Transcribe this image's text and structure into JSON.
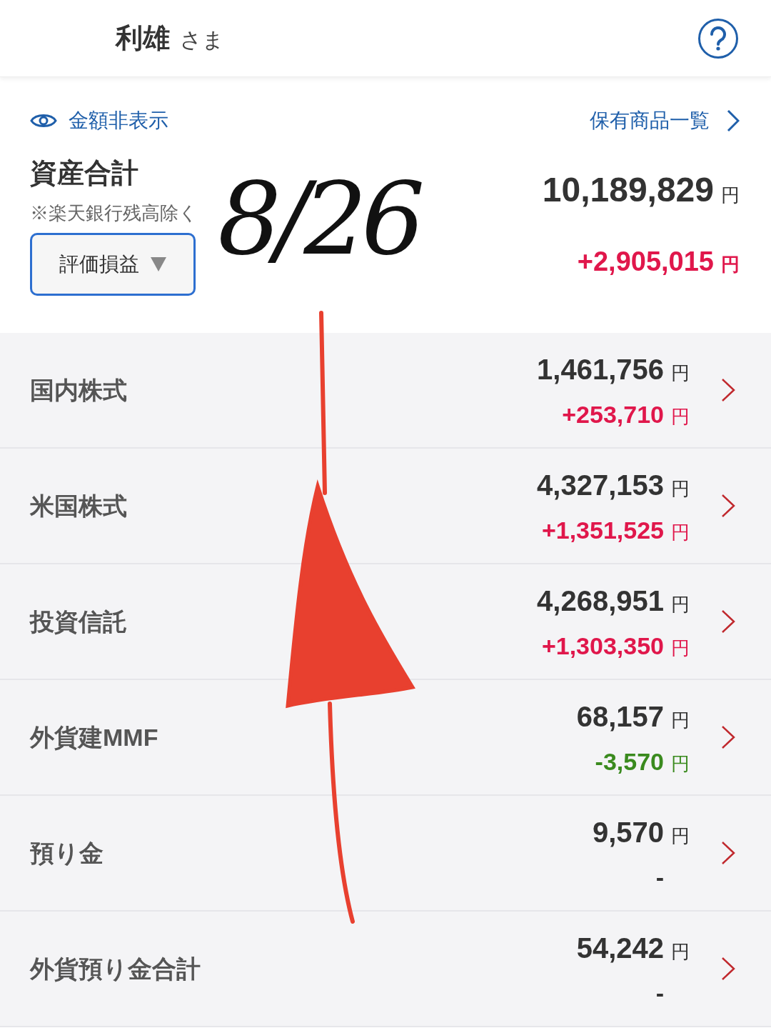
{
  "header": {
    "name": "利雄",
    "honorific": "さま"
  },
  "summary": {
    "hide_amounts": "金額非表示",
    "holdings_link": "保有商品一覧",
    "title": "資産合計",
    "note": "※楽天銀行残高除く",
    "selector": "評価損益",
    "total": {
      "amount": "10,189,829",
      "unit": "円"
    },
    "change": {
      "amount": "+2,905,015",
      "unit": "円",
      "color": "#e0174b"
    }
  },
  "rows": [
    {
      "label": "国内株式",
      "value": {
        "amount": "1,461,756",
        "unit": "円"
      },
      "change": {
        "amount": "+253,710",
        "unit": "円",
        "color": "#e0174b"
      }
    },
    {
      "label": "米国株式",
      "value": {
        "amount": "4,327,153",
        "unit": "円"
      },
      "change": {
        "amount": "+1,351,525",
        "unit": "円",
        "color": "#e0174b"
      }
    },
    {
      "label": "投資信託",
      "value": {
        "amount": "4,268,951",
        "unit": "円"
      },
      "change": {
        "amount": "+1,303,350",
        "unit": "円",
        "color": "#e0174b"
      }
    },
    {
      "label": "外貨建MMF",
      "value": {
        "amount": "68,157",
        "unit": "円"
      },
      "change": {
        "amount": "-3,570",
        "unit": "円",
        "color": "#3a8a1e"
      }
    },
    {
      "label": "預り金",
      "value": {
        "amount": "9,570",
        "unit": "円"
      },
      "change": {
        "amount": "-",
        "color": "#333333"
      }
    },
    {
      "label": "外貨預り金合計",
      "value": {
        "amount": "54,242",
        "unit": "円"
      },
      "change": {
        "amount": "-",
        "color": "#333333"
      }
    }
  ],
  "annotation": {
    "text": "8/26"
  }
}
